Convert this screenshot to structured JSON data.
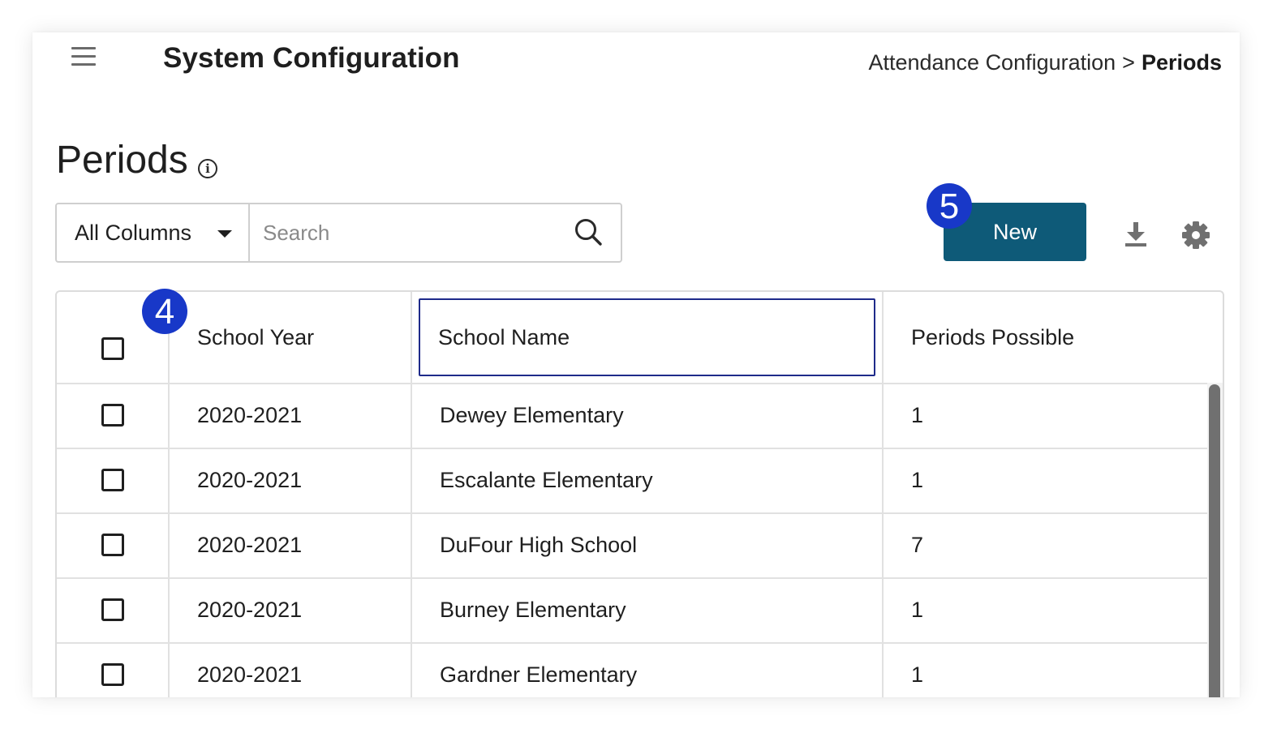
{
  "header": {
    "menu_icon": "hamburger-menu-icon",
    "title": "System Configuration",
    "breadcrumb": {
      "parent": "Attendance Configuration",
      "separator": ">",
      "current": "Periods"
    }
  },
  "page": {
    "title": "Periods",
    "info_icon": "info-icon"
  },
  "toolbar": {
    "column_filter": "All Columns",
    "search_placeholder": "Search",
    "new_label": "New",
    "download_icon": "download-icon",
    "settings_icon": "gear-icon"
  },
  "callouts": {
    "badge_new": "5",
    "badge_school_year": "4",
    "color": "#1838c8"
  },
  "table": {
    "columns": [
      "School Year",
      "School Name",
      "Periods Possible"
    ],
    "rows": [
      {
        "school_year": "2020-2021",
        "school_name": "Dewey Elementary",
        "periods_possible": "1"
      },
      {
        "school_year": "2020-2021",
        "school_name": "Escalante Elementary",
        "periods_possible": "1"
      },
      {
        "school_year": "2020-2021",
        "school_name": "DuFour High School",
        "periods_possible": "7"
      },
      {
        "school_year": "2020-2021",
        "school_name": "Burney Elementary",
        "periods_possible": "1"
      },
      {
        "school_year": "2020-2021",
        "school_name": "Gardner Elementary",
        "periods_possible": "1"
      }
    ]
  },
  "colors": {
    "primary_button": "#0e5a78",
    "focus_outline": "#1e2a8a"
  }
}
